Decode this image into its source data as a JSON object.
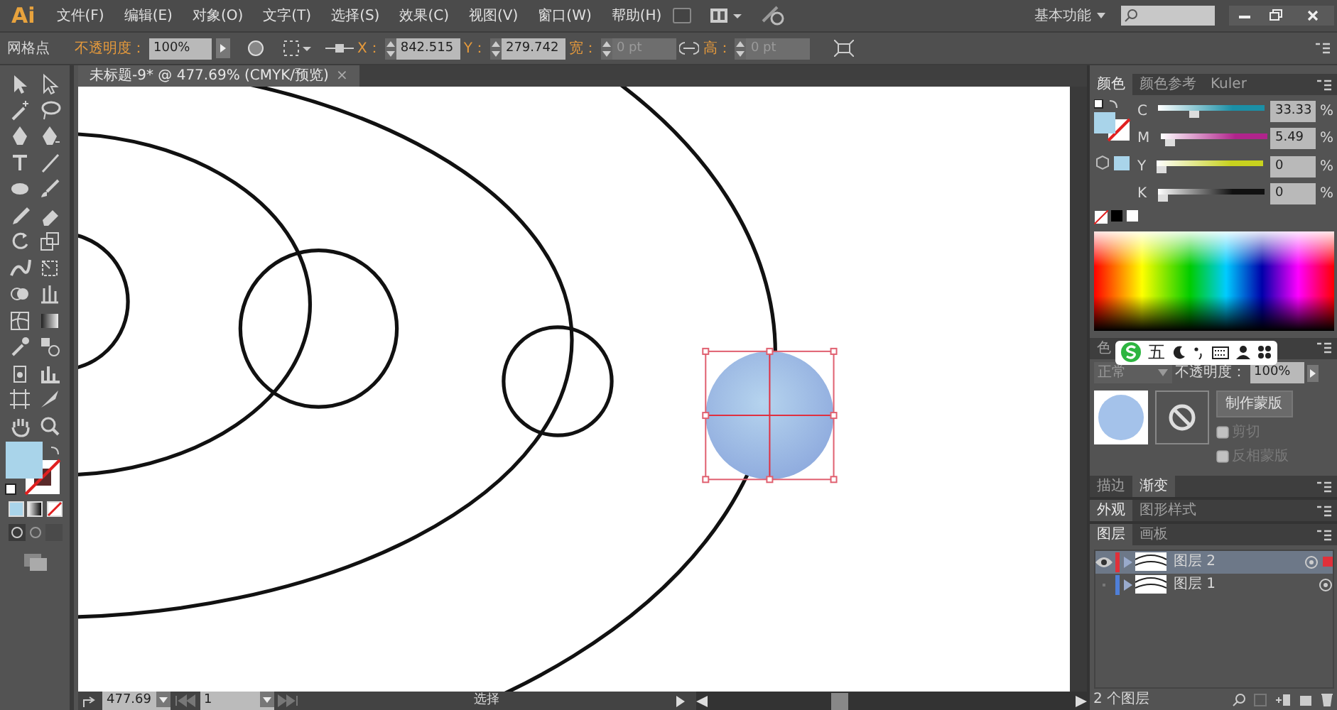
{
  "app": {
    "logo": "Ai"
  },
  "menu": [
    "文件(F)",
    "编辑(E)",
    "对象(O)",
    "文字(T)",
    "选择(S)",
    "效果(C)",
    "视图(V)",
    "窗口(W)",
    "帮助(H)"
  ],
  "workspace": {
    "label": "基本功能"
  },
  "control_bar": {
    "selection_label": "网格点",
    "opacity_label": "不透明度：",
    "opacity_value": "100%",
    "x_label": "X：",
    "x_value": "842.515",
    "y_label": "Y：",
    "y_value": "279.742",
    "width_label": "宽：",
    "width_value": "0 pt",
    "height_label": "高：",
    "height_value": "0 pt"
  },
  "document_tab": {
    "title": "未标题-9* @ 477.69% (CMYK/预览)",
    "close": "×"
  },
  "color_panel": {
    "tabs": [
      {
        "label": "颜色",
        "selected": true
      },
      {
        "label": "颜色参考",
        "selected": false
      },
      {
        "label": "Kuler",
        "selected": false
      }
    ],
    "channels": [
      {
        "name": "C",
        "value": "33.33",
        "unit": "%",
        "level": 0.33,
        "color": "#1b8fa6"
      },
      {
        "name": "M",
        "value": "5.49",
        "unit": "%",
        "level": 0.05,
        "color": "#b0248c"
      },
      {
        "name": "Y",
        "value": "0",
        "unit": "%",
        "level": 0,
        "color": "#c8d21e"
      },
      {
        "name": "K",
        "value": "0",
        "unit": "%",
        "level": 0,
        "color": "#111111"
      }
    ]
  },
  "transparency_panel": {
    "tabs": [
      {
        "label": "色",
        "selected": false
      }
    ],
    "blend_mode": "正常",
    "opacity_label": "不透明度：",
    "opacity_value": "100%",
    "make_mask_button": "制作蒙版",
    "options": [
      {
        "label": "剪切",
        "checked": false
      },
      {
        "label": "反相蒙版",
        "checked": false
      }
    ]
  },
  "ime_toolbar": {
    "label": "五"
  },
  "gradient_panel": {
    "tabs": [
      {
        "label": "描边",
        "selected": false
      },
      {
        "label": "渐变",
        "selected": true
      }
    ]
  },
  "appearance_panel": {
    "tabs": [
      {
        "label": "外观",
        "selected": true
      },
      {
        "label": "图形样式",
        "selected": false
      }
    ]
  },
  "layers_panel": {
    "tabs": [
      {
        "label": "图层",
        "selected": true
      },
      {
        "label": "画板",
        "selected": false
      }
    ],
    "layers": [
      {
        "name": "图层 2",
        "selected": true,
        "visible": true,
        "color": "#e0303a"
      },
      {
        "name": "图层 1",
        "selected": false,
        "visible": false,
        "color": "#4f7fd8"
      }
    ],
    "count": "2 个图层"
  },
  "status_bar": {
    "zoom": "477.69",
    "artboard": "1",
    "tool": "选择"
  }
}
